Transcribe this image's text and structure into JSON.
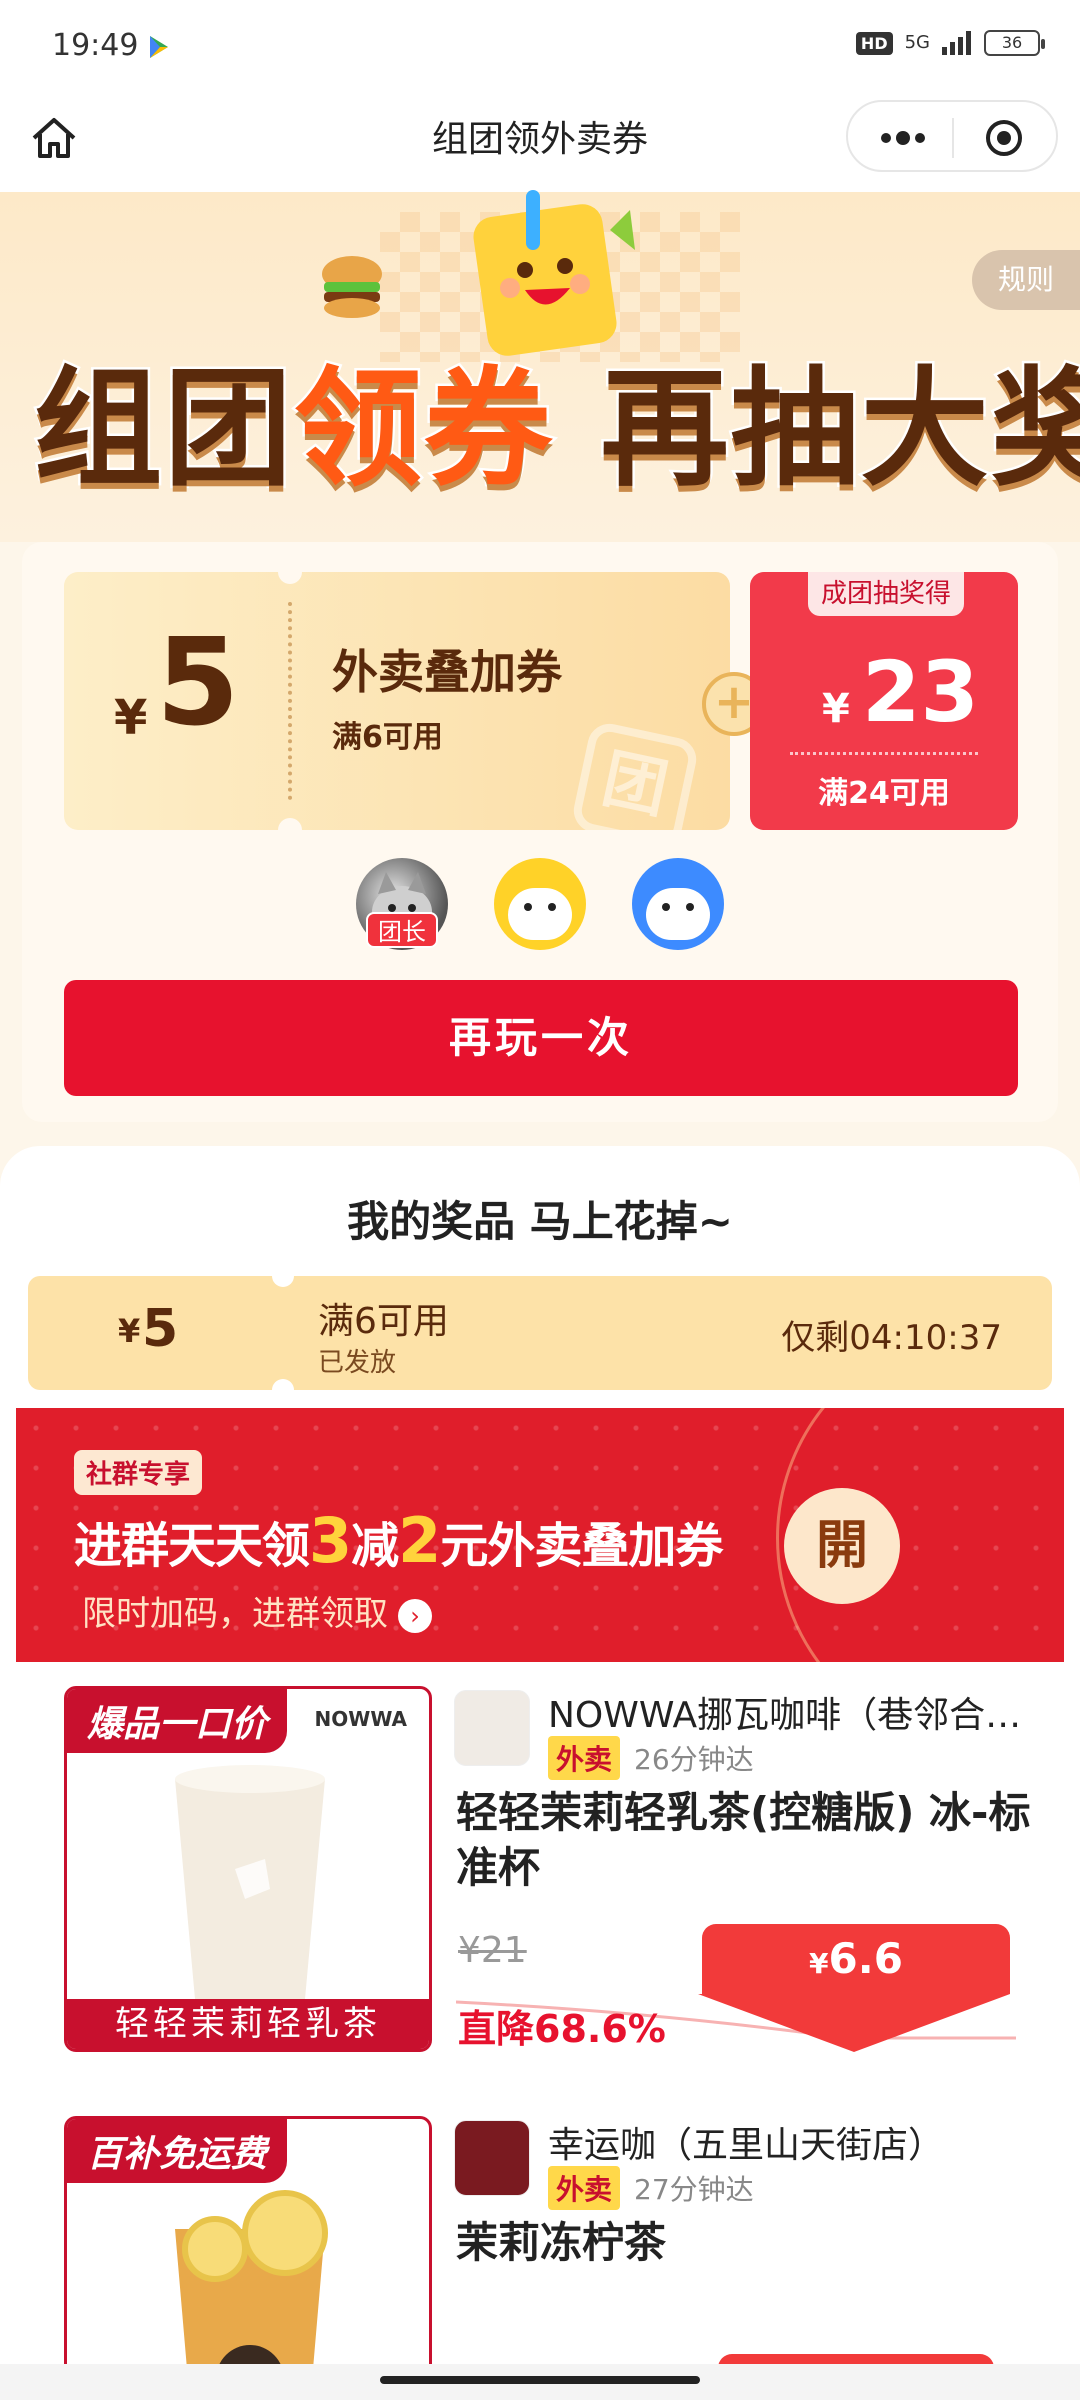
{
  "status_bar": {
    "time": "19:49",
    "hd": "HD",
    "network": "5G",
    "battery": "36"
  },
  "nav": {
    "title": "组团领外卖券",
    "icons": [
      "home-icon",
      "more-dots-icon",
      "target-icon"
    ]
  },
  "banner": {
    "rules": "规则",
    "headline_part1": "组团",
    "headline_part2": "领券",
    "headline_part3": " 再抽大奖"
  },
  "coupon": {
    "yen": "¥",
    "amount": "5",
    "name": "外卖叠加券",
    "condition": "满6可用",
    "watermark": "团",
    "plus": "+",
    "bonus_tag": "成团抽奖得",
    "bonus_yen": "¥",
    "bonus_amount": "23",
    "bonus_condition": "满24可用"
  },
  "team": {
    "leader_label": "团长"
  },
  "play_again": "再玩一次",
  "prizes": {
    "title": "我的奖品 马上花掉~",
    "item": {
      "yen": "¥",
      "amount": "5",
      "condition": "满6可用",
      "status": "已发放",
      "remaining": "仅剩04:10:37"
    }
  },
  "group_banner": {
    "tag": "社群专享",
    "line_a": "进群天天领",
    "num_a": "3",
    "line_b": "减",
    "num_b": "2",
    "line_c": "元外卖叠加券",
    "sub": "限时加码，进群领取",
    "arrow": "›",
    "open": "開"
  },
  "products": [
    {
      "img_tag": "爆品一口价",
      "img_brand": "NOWWA",
      "img_footer": "轻轻茉莉轻乳茶",
      "shop": "NOWWA挪瓦咖啡（巷邻合…",
      "badge": "外卖",
      "eta": "26分钟达",
      "name": "轻轻茉莉轻乳茶(控糖版) 冰-标准杯",
      "original_price": "¥21",
      "price_yen": "¥",
      "price": "6.6",
      "discount": "直降68.6%"
    },
    {
      "img_tag": "百补免运费",
      "shop": "幸运咖（五里山天街店）",
      "badge": "外卖",
      "eta": "27分钟达",
      "name": "茉莉冻柠茶"
    }
  ],
  "colors": {
    "primary_red": "#e7122e",
    "brown_text": "#5a2a0c",
    "coupon_gold": "#fcdca3",
    "accent_orange": "#ff5a14"
  }
}
